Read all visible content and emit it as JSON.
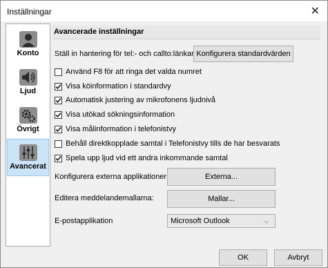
{
  "window": {
    "title": "Inställningar"
  },
  "sidebar": {
    "items": [
      {
        "label": "Konto",
        "icon": "person-icon",
        "active": false
      },
      {
        "label": "Ljud",
        "icon": "speaker-icon",
        "active": false
      },
      {
        "label": "Övrigt",
        "icon": "gears-icon",
        "active": false
      },
      {
        "label": "Avancerat",
        "icon": "sliders-icon",
        "active": true
      }
    ]
  },
  "main": {
    "header": "Avancerade inställningar",
    "handler_label": "Ställ in hantering för tel:- och callto:länkar",
    "handler_button": "Konfigurera standardvärden",
    "checkboxes": [
      {
        "label": "Använd F8 för att ringa det valda numret",
        "checked": false
      },
      {
        "label": "Visa köinformation i standardvy",
        "checked": true
      },
      {
        "label": "Automatisk justering av mikrofonens ljudnivå",
        "checked": true
      },
      {
        "label": "Visa utökad sökningsinformation",
        "checked": true
      },
      {
        "label": "Visa målinformation i telefonistvy",
        "checked": true
      },
      {
        "label": "Behåll direktkopplade samtal i Telefonistvy tills de har besvarats",
        "checked": false
      },
      {
        "label": "Spela upp ljud vid ett andra inkommande samtal",
        "checked": true
      }
    ],
    "external_label": "Konfigurera externa applikationer:",
    "external_button": "Externa...",
    "templates_label": "Editera meddelandemallarna:",
    "templates_button": "Mallar...",
    "email_label": "E-postapplikation",
    "email_value": "Microsoft Outlook"
  },
  "footer": {
    "ok": "OK",
    "cancel": "Avbryt"
  }
}
